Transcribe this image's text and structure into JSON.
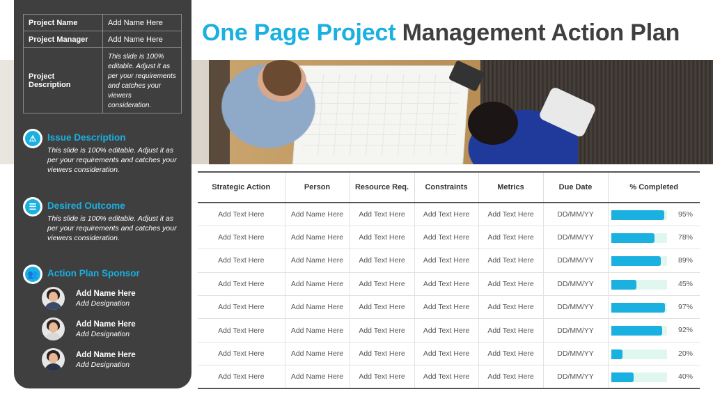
{
  "title": {
    "accent": "One Page Project",
    "rest": "Management Action Plan"
  },
  "info": [
    {
      "key": "Project Name",
      "value": "Add Name Here"
    },
    {
      "key": "Project Manager",
      "value": "Add Name Here"
    },
    {
      "key": "Project Description",
      "value": "This slide is 100% editable. Adjust it as per your requirements and catches your viewers consideration."
    }
  ],
  "sections": [
    {
      "title": "Issue Description",
      "icon": "warning-icon",
      "text": "This slide is 100%  editable. Adjust it as per your requirements and catches your viewers consideration."
    },
    {
      "title": "Desired Outcome",
      "icon": "document-list-icon",
      "text": "This slide is 100%  editable. Adjust it as per your requirements and catches your viewers consideration."
    },
    {
      "title": "Action Plan Sponsor",
      "icon": "people-icon"
    }
  ],
  "sponsors": [
    {
      "name": "Add Name Here",
      "designation": "Add Designation"
    },
    {
      "name": "Add Name Here",
      "designation": "Add Designation"
    },
    {
      "name": "Add Name Here",
      "designation": "Add Designation"
    }
  ],
  "table": {
    "headers": [
      "Strategic Action",
      "Person",
      "Resource Req.",
      "Constraints",
      "Metrics",
      "Due Date",
      "% Completed"
    ],
    "rows": [
      {
        "action": "Add Text Here",
        "person": "Add Name Here",
        "resource": "Add Text Here",
        "constraints": "Add Text Here",
        "metrics": "Add Text Here",
        "due": "DD/MM/YY",
        "pct_label": "95%",
        "pct": 95
      },
      {
        "action": "Add Text Here",
        "person": "Add Name Here",
        "resource": "Add Text Here",
        "constraints": "Add Text Here",
        "metrics": "Add Text Here",
        "due": "DD/MM/YY",
        "pct_label": "78%",
        "pct": 78
      },
      {
        "action": "Add Text Here",
        "person": "Add Name Here",
        "resource": "Add Text Here",
        "constraints": "Add Text Here",
        "metrics": "Add Text Here",
        "due": "DD/MM/YY",
        "pct_label": "89%",
        "pct": 89
      },
      {
        "action": "Add Text Here",
        "person": "Add Name Here",
        "resource": "Add Text Here",
        "constraints": "Add Text Here",
        "metrics": "Add Text Here",
        "due": "DD/MM/YY",
        "pct_label": "45%",
        "pct": 45
      },
      {
        "action": "Add Text Here",
        "person": "Add Name Here",
        "resource": "Add Text Here",
        "constraints": "Add Text Here",
        "metrics": "Add Text Here",
        "due": "DD/MM/YY",
        "pct_label": "97%",
        "pct": 97
      },
      {
        "action": "Add Text Here",
        "person": "Add Name Here",
        "resource": "Add Text Here",
        "constraints": "Add Text Here",
        "metrics": "Add Text Here",
        "due": "DD/MM/YY",
        "pct_label": "92%",
        "pct": 92
      },
      {
        "action": "Add Text Here",
        "person": "Add Name Here",
        "resource": "Add Text Here",
        "constraints": "Add Text Here",
        "metrics": "Add Text Here",
        "due": "DD/MM/YY",
        "pct_label": "20%",
        "pct": 20
      },
      {
        "action": "Add Text Here",
        "person": "Add Name Here",
        "resource": "Add Text Here",
        "constraints": "Add Text Here",
        "metrics": "Add Text Here",
        "due": "DD/MM/YY",
        "pct_label": "40%",
        "pct": 40
      }
    ]
  },
  "colors": {
    "accent": "#1ab0e0",
    "panel": "#3f3f3f",
    "bar_track": "#dff7ee"
  }
}
